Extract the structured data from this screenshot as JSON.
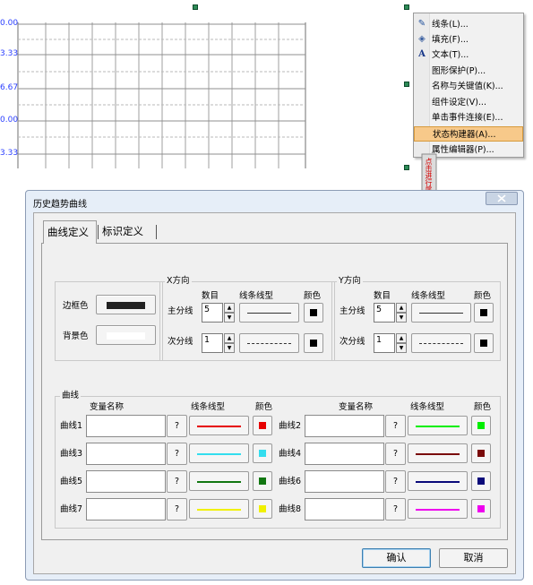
{
  "chart": {
    "y_ticks": [
      "0.00",
      "3.33",
      "6.67",
      "0.00",
      "3.33"
    ]
  },
  "context_menu": {
    "items": [
      {
        "icon": "line-tool-icon",
        "glyph": "✎",
        "label": "线条(L)..."
      },
      {
        "icon": "fill-bucket-icon",
        "glyph": "◈",
        "label": "填充(F)..."
      },
      {
        "icon": "text-a-icon",
        "glyph": "A",
        "label": "文本(T)..."
      },
      {
        "icon": "",
        "glyph": "",
        "label": "图形保护(P)..."
      },
      {
        "icon": "",
        "glyph": "",
        "label": "名称与关键值(K)..."
      },
      {
        "icon": "",
        "glyph": "",
        "label": "组件设定(V)..."
      },
      {
        "icon": "",
        "glyph": "",
        "label": "单击事件连接(E)..."
      },
      {
        "icon": "",
        "glyph": "",
        "label": "状态构建器(A)..."
      },
      {
        "icon": "",
        "glyph": "",
        "label": "属性编辑器(P)..."
      }
    ],
    "highlight_color": "#f7c98a"
  },
  "callout": {
    "text": "点击进行属性设置"
  },
  "dialog": {
    "title": "历史趋势曲线",
    "tabs": [
      "曲线定义",
      "标识定义"
    ],
    "border_group": {
      "border_color_label": "边框色",
      "background_label": "背景色",
      "border_color": "#222222",
      "background_color": "#ffffff"
    },
    "x_group": {
      "title": "X方向",
      "count_header": "数目",
      "linetype_header": "线条线型",
      "color_header": "颜色",
      "main_label": "主分线",
      "main_count": "5",
      "minor_label": "次分线",
      "minor_count": "1"
    },
    "y_group": {
      "title": "Y方向",
      "count_header": "数目",
      "linetype_header": "线条线型",
      "color_header": "颜色",
      "main_label": "主分线",
      "main_count": "5",
      "minor_label": "次分线",
      "minor_count": "1"
    },
    "curves_group": {
      "title": "曲线",
      "var_header": "变量名称",
      "linetype_header": "线条线型",
      "color_header": "颜色",
      "q_label": "?",
      "curves": [
        {
          "label": "曲线1",
          "color": "#e60000"
        },
        {
          "label": "曲线2",
          "color": "#00ee00"
        },
        {
          "label": "曲线3",
          "color": "#33ddee"
        },
        {
          "label": "曲线4",
          "color": "#7a0a0a"
        },
        {
          "label": "曲线5",
          "color": "#117711"
        },
        {
          "label": "曲线6",
          "color": "#0a0a7a"
        },
        {
          "label": "曲线7",
          "color": "#f0f000"
        },
        {
          "label": "曲线8",
          "color": "#ee00ee"
        }
      ]
    },
    "ok_label": "确认",
    "cancel_label": "取消"
  }
}
